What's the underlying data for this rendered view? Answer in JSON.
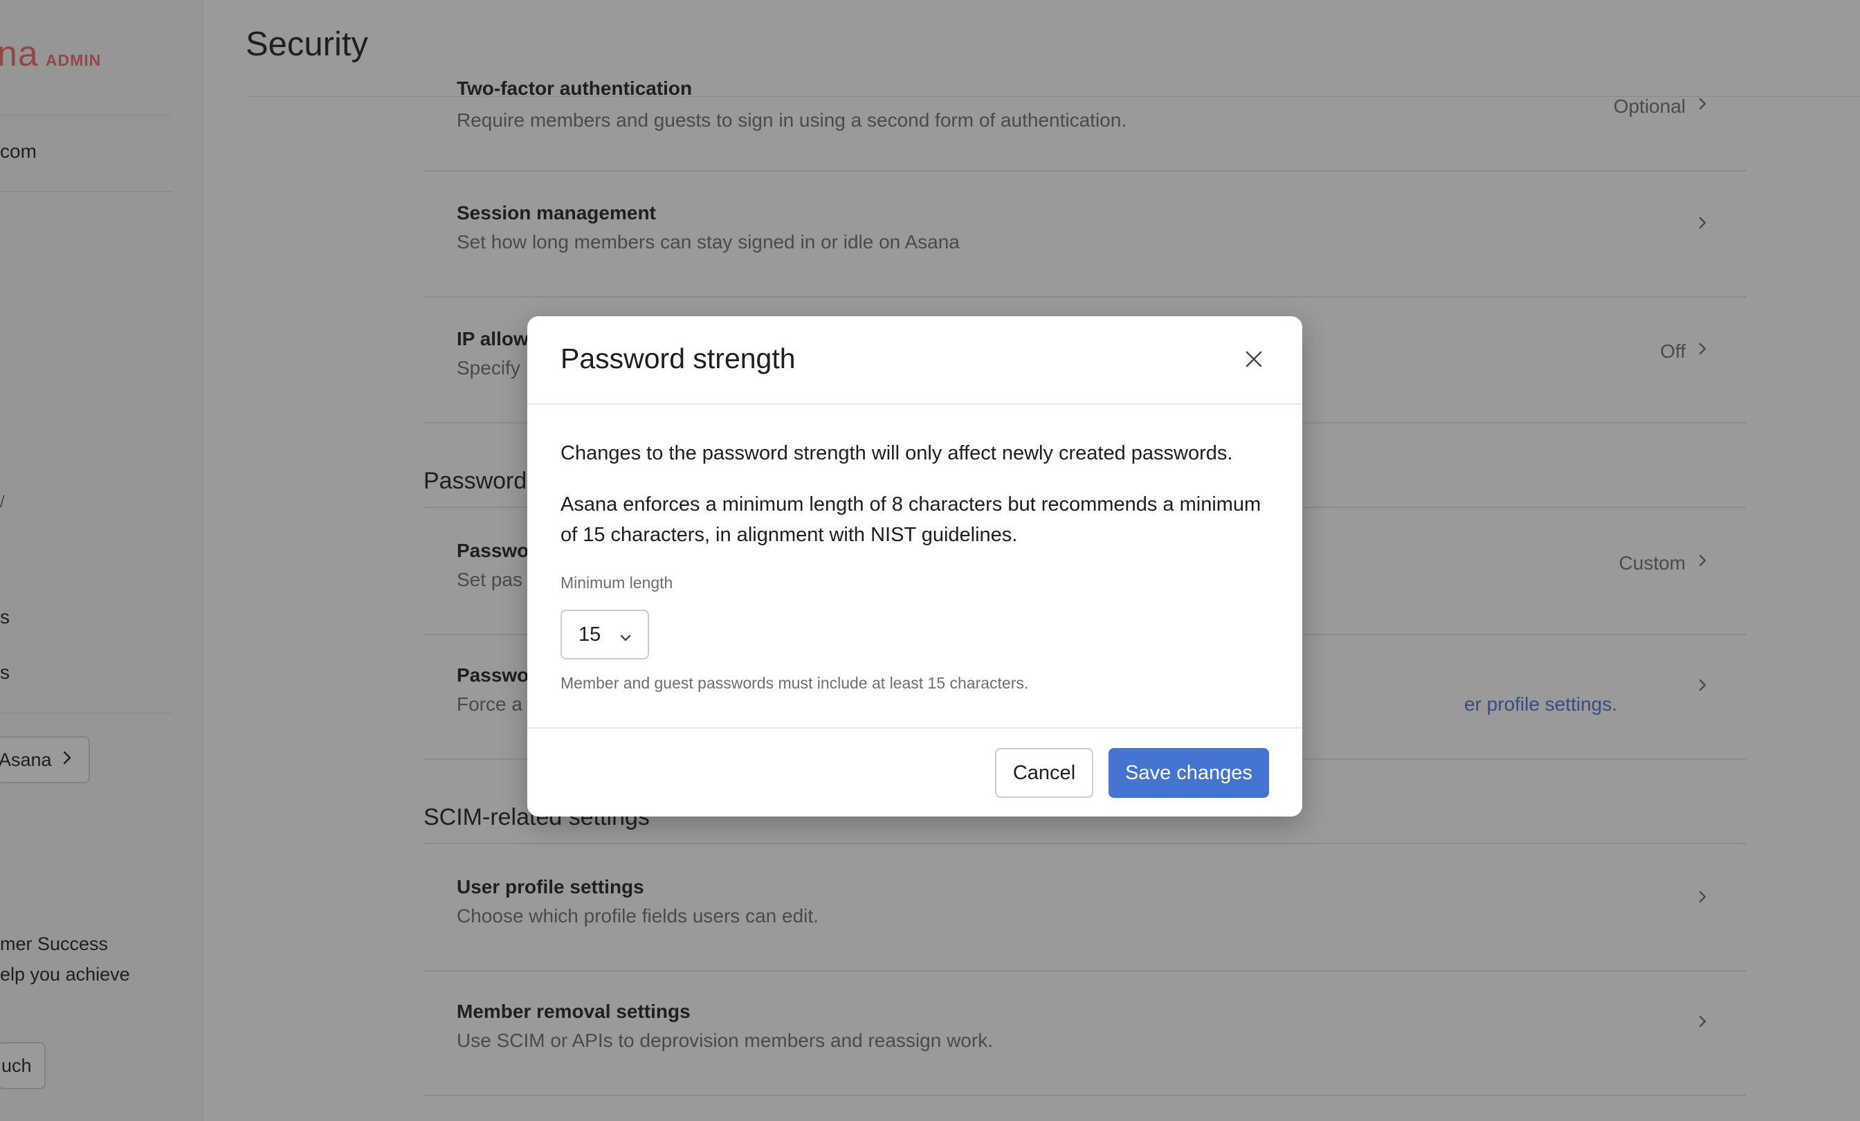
{
  "sidebar": {
    "logo_word": "na",
    "logo_badge": "ADMIN",
    "domain": "com",
    "item_a": "s",
    "item_b": "s",
    "back_button": "Asana",
    "promo_line1": "mer Success",
    "promo_line2": "elp you achieve",
    "contact_button": "uch",
    "stray_mark": "/"
  },
  "header": {
    "title": "Security"
  },
  "rows": {
    "two_factor": {
      "title": "Two-factor authentication",
      "desc": "Require members and guests to sign in using a second form of authentication.",
      "value": "Optional"
    },
    "session": {
      "title": "Session management",
      "desc": "Set how long members can stay signed in or idle on Asana"
    },
    "ip": {
      "title": "IP allow",
      "desc": "Specify",
      "value": "Off"
    },
    "pw_strength": {
      "title": "Passwo",
      "desc": "Set pas",
      "value": "Custom"
    },
    "pw_reset": {
      "title": "Passwo",
      "desc": "Force a",
      "link": "er profile settings."
    },
    "user_profile": {
      "title": "User profile settings",
      "desc": "Choose which profile fields users can edit."
    },
    "member_removal": {
      "title": "Member removal settings",
      "desc": "Use SCIM or APIs to deprovision members and reassign work."
    }
  },
  "sections": {
    "password": "Password",
    "scim": "SCIM-related settings"
  },
  "modal": {
    "title": "Password strength",
    "line1": "Changes to the password strength will only affect newly created passwords.",
    "line2": "Asana enforces a minimum length of 8 characters but recommends a minimum of 15 characters, in alignment with NIST guidelines.",
    "field_label": "Minimum length",
    "selected_value": "15",
    "help_text": "Member and guest passwords must include at least 15 characters.",
    "cancel": "Cancel",
    "save": "Save changes"
  },
  "colors": {
    "accent": "#4573d2",
    "brand": "#f06a6a",
    "overlay": "rgba(30,31,33,0.45)"
  },
  "icons": {
    "close": "close-icon",
    "chevron": "chevron-right-icon",
    "caret": "chevron-down-icon"
  }
}
